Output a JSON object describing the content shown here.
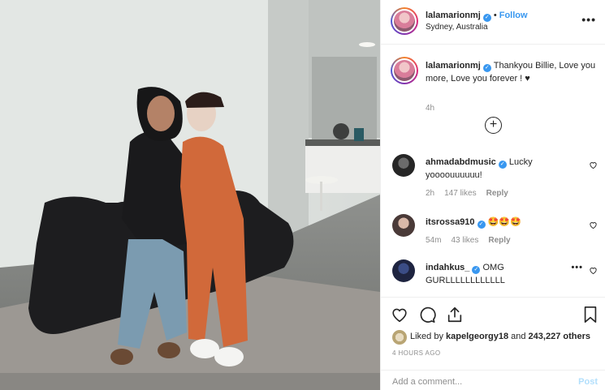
{
  "post": {
    "username": "lalamarionmj",
    "follow_label": "Follow",
    "location": "Sydney, Australia",
    "more_label": "•••"
  },
  "caption": {
    "username": "lalamarionmj",
    "text": "Thankyou Billie, Love you more, Love you forever ! ♥",
    "time": "4h"
  },
  "load_more_label": "+",
  "comments": [
    {
      "username": "ahmadabdmusic",
      "text": "Lucky yoooouuuuuu!",
      "time": "2h",
      "likes": "147 likes",
      "reply": "Reply"
    },
    {
      "username": "itsrossa910",
      "text": "🤩🤩🤩",
      "time": "54m",
      "likes": "43 likes",
      "reply": "Reply"
    },
    {
      "username": "indahkus_",
      "text": "OMG GURLLLLLLLLLLLL",
      "more_label": "•••"
    }
  ],
  "actions": {
    "icons": [
      "heart-icon",
      "comment-icon",
      "share-icon",
      "bookmark-icon"
    ],
    "liked_by_prefix": "Liked by ",
    "liked_by_user": "kapelgeorgy18",
    "liked_by_mid": " and ",
    "liked_by_count": "243,227 others",
    "timestamp": "4 HOURS AGO"
  },
  "add_comment": {
    "placeholder": "Add a comment...",
    "post_label": "Post"
  },
  "colors": {
    "link": "#3897f0",
    "muted": "#8e8e8e",
    "post_disabled": "#b2dffc"
  }
}
